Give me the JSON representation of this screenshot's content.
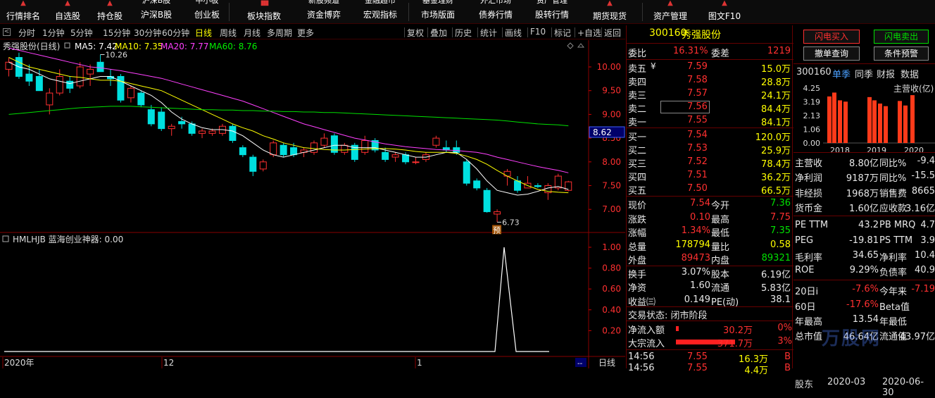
{
  "topbar": {
    "items": [
      "行情排名",
      "自选股",
      "持仓股",
      "沪深B股",
      "创业板",
      "板块指数",
      "资金博弈",
      "宏观指标",
      "市场版面",
      "债券行情",
      "股转行情",
      "期货现货",
      "资产管理",
      "图文F10"
    ],
    "clipped_top": [
      "沪深B股",
      "中小板",
      "资金流向",
      "新股频道",
      "金融超市",
      "基金理财",
      "外汇市场",
      "资产管理"
    ]
  },
  "timeframes": {
    "items": [
      "分时",
      "1分钟",
      "5分钟",
      "15分钟",
      "30分钟",
      "60分钟",
      "日线",
      "周线",
      "月线",
      "多周期",
      "更多"
    ],
    "selected": "日线",
    "tools": [
      "复权",
      "叠加",
      "历史",
      "统计",
      "画线",
      "F10",
      "标记",
      "+自选",
      "返回"
    ]
  },
  "chart": {
    "title": "秀强股份(日线)",
    "ma5": "MA5: 7.42",
    "ma10": "MA10: 7.35",
    "ma20": "MA20: 7.77",
    "ma60": "MA60: 8.76",
    "hi_label": "10.26",
    "lo_label": "6.73",
    "yu": "预",
    "cur_price": "8.62",
    "y_ticks": [
      "10.00",
      "9.50",
      "9.00",
      "8.50",
      "8.00",
      "7.50",
      "7.00"
    ],
    "x_labels": [
      "2020年",
      "12",
      "1"
    ],
    "ind_title": "HMLHJB 蓝海创业神器: 0.00",
    "ind_ticks": [
      "1.00",
      "0.80",
      "0.60",
      "0.40",
      "0.20"
    ],
    "period_btn": "日线"
  },
  "quote": {
    "code": "300160",
    "name": "秀强股份",
    "weibi_label": "委比",
    "weibi": "16.31%",
    "weicha_label": "委差",
    "weicha": "1219",
    "sell": [
      {
        "l": "卖五",
        "p": "7.59",
        "v": "15.0万"
      },
      {
        "l": "卖四",
        "p": "7.58",
        "v": "28.8万"
      },
      {
        "l": "卖三",
        "p": "7.57",
        "v": "24.1万"
      },
      {
        "l": "卖二",
        "p": "7.56",
        "v": "84.4万"
      },
      {
        "l": "卖一",
        "p": "7.55",
        "v": "84.1万"
      }
    ],
    "buy": [
      {
        "l": "买一",
        "p": "7.54",
        "v": "120.0万"
      },
      {
        "l": "买二",
        "p": "7.53",
        "v": "25.9万"
      },
      {
        "l": "买三",
        "p": "7.52",
        "v": "78.4万"
      },
      {
        "l": "买四",
        "p": "7.51",
        "v": "36.2万"
      },
      {
        "l": "买五",
        "p": "7.50",
        "v": "66.5万"
      }
    ],
    "stats": [
      {
        "a": "现价",
        "av": "7.54",
        "b": "今开",
        "bv": "7.36"
      },
      {
        "a": "涨跌",
        "av": "0.10",
        "b": "最高",
        "bv": "7.75"
      },
      {
        "a": "涨幅",
        "av": "1.34%",
        "b": "最低",
        "bv": "7.35"
      },
      {
        "a": "总量",
        "av": "178794",
        "b": "量比",
        "bv": "0.58"
      },
      {
        "a": "外盘",
        "av": "89473",
        "b": "内盘",
        "bv": "89321"
      },
      {
        "a": "换手",
        "av": "3.07%",
        "b": "股本",
        "bv": "6.19亿"
      },
      {
        "a": "净资",
        "av": "1.60",
        "b": "流通",
        "bv": "5.83亿"
      },
      {
        "a": "收益㈢",
        "av": "0.149",
        "b": "PE(动)",
        "bv": "38.1"
      }
    ],
    "status": "交易状态: 闭市阶段",
    "flow": [
      {
        "l": "净流入额",
        "v": "30.2万",
        "p": "0%"
      },
      {
        "l": "大宗流入",
        "v": "371.7万",
        "p": "3%"
      }
    ],
    "ticks": [
      {
        "t": "14:56",
        "p": "7.55",
        "v": "16.3万",
        "d": "B"
      },
      {
        "t": "14:56",
        "p": "7.55",
        "v": "4.4万",
        "d": "B"
      }
    ]
  },
  "rpanel": {
    "btn_buy": "闪电买入",
    "btn_sell": "闪电卖出",
    "btn_cancel": "撤单查询",
    "btn_cond": "条件预警",
    "code": "300160",
    "tabs": [
      "单季",
      "同季",
      "财报",
      "数据"
    ],
    "bar_title": "主营收(亿)",
    "y_ticks": [
      "4.25",
      "3.19",
      "2.13",
      "1.06",
      "0.00"
    ],
    "years": [
      "2018",
      "2019",
      "2020"
    ],
    "bar_values": [
      3.6,
      3.9,
      3.3,
      3.2,
      3.55,
      3.3,
      3.05,
      2.85,
      3.25,
      2.9,
      3.7
    ],
    "rows": [
      {
        "a": "主营收",
        "av": "8.80亿",
        "b": "同比%",
        "bv": "-9.4"
      },
      {
        "a": "净利润",
        "av": "9187万",
        "b": "同比%",
        "bv": "-15.5"
      },
      {
        "a": "非经损",
        "av": "1968万",
        "b": "销售费",
        "bv": "8665"
      },
      {
        "a": "货币金",
        "av": "1.60亿",
        "b": "应收款",
        "bv": "3.16亿"
      },
      {
        "a": "PE TTM",
        "av": "43.2",
        "b": "PB MRQ",
        "bv": "4.7"
      },
      {
        "a": "PEG",
        "av": "-19.81",
        "b": "PS TTM",
        "bv": "3.9"
      },
      {
        "a": "毛利率",
        "av": "34.65",
        "b": "净利率",
        "bv": "10.4"
      },
      {
        "a": "ROE",
        "av": "9.29%",
        "b": "负债率",
        "bv": "40.9"
      },
      {
        "a": "20日i",
        "av": "-7.6%",
        "b": "今年来",
        "bv": "-7.19"
      },
      {
        "a": "60日",
        "av": "-17.6%",
        "b": "Beta值",
        "bv": ""
      },
      {
        "a": "年最高",
        "av": "13.54",
        "b": "年最低",
        "bv": ""
      },
      {
        "a": "总市值",
        "av": "46.64亿",
        "b": "流通值",
        "bv": "43.97亿"
      }
    ],
    "foot_left": "股东",
    "foot_date": "2020-03",
    "foot_right": "2020-06-30"
  },
  "watermark": "万股网",
  "colors": {
    "up": "#ff3030",
    "down": "#00e0e0",
    "ma5": "#ffffff",
    "ma10": "#ffff00",
    "ma20": "#ff40ff",
    "ma60": "#00e000"
  },
  "candles": [
    [
      9.95,
      10.2,
      9.8,
      10.1
    ],
    [
      10.2,
      10.3,
      9.75,
      9.8
    ],
    [
      9.85,
      10.05,
      9.6,
      9.7
    ],
    [
      9.8,
      9.95,
      9.5,
      9.5
    ],
    [
      9.2,
      9.55,
      9.0,
      9.45
    ],
    [
      9.45,
      9.95,
      9.4,
      9.8
    ],
    [
      9.7,
      9.8,
      9.45,
      9.55
    ],
    [
      9.6,
      10.1,
      9.55,
      10.0
    ],
    [
      9.85,
      10.05,
      9.6,
      9.95
    ],
    [
      10.1,
      10.26,
      9.9,
      9.9
    ],
    [
      9.8,
      9.95,
      9.6,
      9.75
    ],
    [
      9.8,
      9.85,
      9.25,
      9.3
    ],
    [
      9.35,
      9.6,
      9.25,
      9.55
    ],
    [
      9.45,
      9.5,
      9.15,
      9.2
    ],
    [
      9.1,
      9.2,
      8.75,
      8.8
    ],
    [
      9.05,
      9.15,
      8.65,
      8.7
    ],
    [
      8.7,
      8.8,
      8.55,
      8.75
    ],
    [
      8.85,
      8.95,
      8.7,
      8.8
    ],
    [
      8.8,
      8.85,
      8.55,
      8.6
    ],
    [
      8.6,
      8.7,
      8.5,
      8.65
    ],
    [
      8.6,
      8.7,
      8.55,
      8.65
    ],
    [
      8.6,
      8.8,
      8.55,
      8.75
    ],
    [
      8.75,
      8.8,
      8.4,
      8.45
    ],
    [
      8.3,
      8.35,
      8.1,
      8.15
    ],
    [
      8.1,
      8.15,
      7.7,
      7.8
    ],
    [
      7.85,
      8.05,
      7.8,
      8.0
    ],
    [
      8.15,
      8.45,
      8.1,
      8.4
    ],
    [
      8.35,
      8.4,
      8.1,
      8.15
    ],
    [
      8.3,
      8.4,
      8.1,
      8.15
    ],
    [
      8.2,
      8.3,
      8.1,
      8.25
    ],
    [
      8.2,
      8.45,
      8.15,
      8.4
    ],
    [
      8.35,
      8.6,
      8.3,
      8.5
    ],
    [
      8.55,
      8.6,
      8.15,
      8.2
    ],
    [
      8.2,
      8.4,
      8.15,
      8.35
    ],
    [
      8.35,
      8.4,
      8.0,
      8.05
    ],
    [
      8.2,
      8.55,
      8.15,
      8.45
    ],
    [
      8.45,
      8.5,
      8.2,
      8.25
    ],
    [
      8.2,
      8.3,
      8.0,
      8.05
    ],
    [
      8.1,
      8.2,
      8.0,
      8.15
    ],
    [
      8.15,
      8.2,
      7.95,
      8.0
    ],
    [
      8.0,
      8.1,
      7.95,
      8.0
    ],
    [
      8.05,
      8.2,
      8.0,
      8.15
    ],
    [
      8.35,
      8.55,
      8.3,
      8.5
    ],
    [
      8.3,
      8.45,
      8.2,
      8.25
    ],
    [
      8.3,
      8.45,
      8.15,
      8.2
    ],
    [
      8.0,
      8.05,
      7.5,
      7.55
    ],
    [
      7.6,
      7.65,
      7.4,
      7.45
    ],
    [
      7.4,
      7.45,
      6.93,
      6.95
    ],
    [
      6.9,
      7.0,
      6.73,
      6.95
    ],
    [
      7.7,
      7.85,
      7.5,
      7.8
    ],
    [
      7.6,
      7.7,
      7.35,
      7.4
    ],
    [
      7.45,
      7.7,
      7.45,
      7.55
    ],
    [
      7.5,
      7.55,
      7.45,
      7.48
    ],
    [
      7.35,
      7.55,
      7.2,
      7.5
    ],
    [
      7.45,
      7.75,
      7.4,
      7.7
    ],
    [
      7.4,
      7.6,
      7.38,
      7.58
    ]
  ],
  "ma_series": {
    "ma5": [
      10.1,
      10.0,
      9.95,
      9.85,
      9.75,
      9.7,
      9.65,
      9.7,
      9.75,
      9.8,
      9.8,
      9.7,
      9.6,
      9.5,
      9.4,
      9.25,
      9.05,
      8.9,
      8.8,
      8.72,
      8.68,
      8.68,
      8.65,
      8.55,
      8.4,
      8.25,
      8.15,
      8.1,
      8.15,
      8.2,
      8.25,
      8.3,
      8.35,
      8.35,
      8.3,
      8.3,
      8.3,
      8.25,
      8.2,
      8.15,
      8.1,
      8.1,
      8.15,
      8.2,
      8.2,
      8.05,
      7.85,
      7.6,
      7.4,
      7.35,
      7.3,
      7.32,
      7.38,
      7.45,
      7.48,
      7.42
    ],
    "ma10": [
      10.2,
      10.1,
      10.0,
      9.95,
      9.9,
      9.85,
      9.8,
      9.78,
      9.75,
      9.72,
      9.72,
      9.7,
      9.65,
      9.6,
      9.55,
      9.5,
      9.4,
      9.3,
      9.2,
      9.1,
      9.0,
      8.9,
      8.8,
      8.72,
      8.65,
      8.55,
      8.48,
      8.4,
      8.35,
      8.3,
      8.28,
      8.26,
      8.25,
      8.25,
      8.26,
      8.27,
      8.28,
      8.28,
      8.27,
      8.25,
      8.22,
      8.2,
      8.2,
      8.2,
      8.18,
      8.12,
      8.05,
      7.95,
      7.82,
      7.7,
      7.6,
      7.5,
      7.42,
      7.38,
      7.36,
      7.35
    ],
    "ma20": [
      10.4,
      10.35,
      10.3,
      10.25,
      10.2,
      10.15,
      10.1,
      10.05,
      10.0,
      9.98,
      9.95,
      9.92,
      9.88,
      9.84,
      9.8,
      9.76,
      9.7,
      9.64,
      9.58,
      9.52,
      9.46,
      9.4,
      9.34,
      9.28,
      9.2,
      9.12,
      9.04,
      8.96,
      8.88,
      8.8,
      8.74,
      8.68,
      8.62,
      8.56,
      8.5,
      8.46,
      8.42,
      8.38,
      8.35,
      8.32,
      8.3,
      8.28,
      8.26,
      8.25,
      8.24,
      8.22,
      8.2,
      8.16,
      8.1,
      8.05,
      8.0,
      7.95,
      7.9,
      7.86,
      7.82,
      7.77
    ],
    "ma60": [
      9.0,
      9.02,
      9.04,
      9.06,
      9.08,
      9.1,
      9.12,
      9.14,
      9.15,
      9.16,
      9.17,
      9.17,
      9.17,
      9.16,
      9.15,
      9.14,
      9.13,
      9.12,
      9.11,
      9.1,
      9.1,
      9.09,
      9.09,
      9.08,
      9.08,
      9.07,
      9.07,
      9.06,
      9.06,
      9.05,
      9.05,
      9.04,
      9.04,
      9.03,
      9.02,
      9.01,
      9.0,
      8.99,
      8.98,
      8.97,
      8.96,
      8.95,
      8.94,
      8.93,
      8.92,
      8.91,
      8.9,
      8.89,
      8.88,
      8.86,
      8.84,
      8.82,
      8.8,
      8.79,
      8.78,
      8.76
    ]
  }
}
